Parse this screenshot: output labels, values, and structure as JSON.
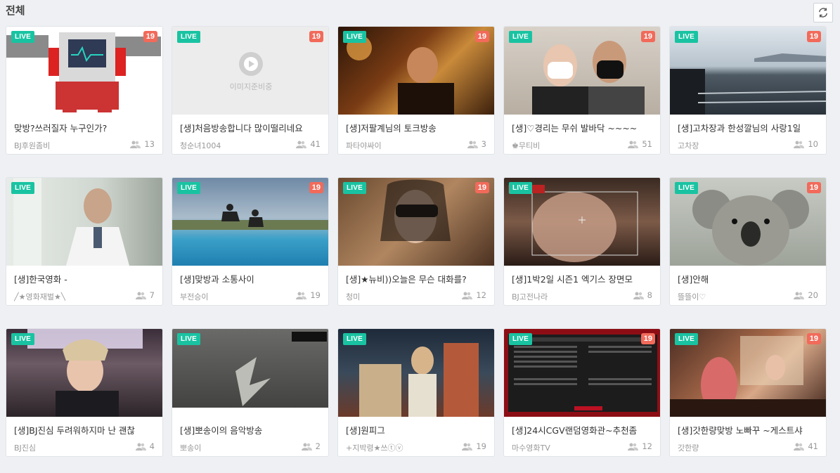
{
  "page": {
    "title": "전체"
  },
  "cards": [
    {
      "title": "맞방?쓰러질자 누구인가?",
      "bj": "BJ후원좀비",
      "viewers": "13",
      "live": "LIVE",
      "age": "19"
    },
    {
      "title": "[생]처음방송합니다 많이떨리네요",
      "bj": "청순녀1004",
      "viewers": "41",
      "live": "LIVE",
      "age": "19",
      "placeholder": "이미지준비중"
    },
    {
      "title": "[생]저팔계님의 토크방송",
      "bj": "파타야싸이",
      "viewers": "3",
      "live": "LIVE",
      "age": "19"
    },
    {
      "title": "[생]♡경리는 무쉬 발바닥 ~~~~",
      "bj": "♚무티비",
      "viewers": "51",
      "live": "LIVE",
      "age": "19"
    },
    {
      "title": "[생]고차장과 한성깔님의 사랑1일",
      "bj": "고차장",
      "viewers": "10",
      "live": "LIVE",
      "age": "19"
    },
    {
      "title": "[생]한국영화 -",
      "bj": "╱★영화재벌★╲",
      "viewers": "7",
      "live": "LIVE"
    },
    {
      "title": "[생]맞방과 소통사이",
      "bj": "부전승이",
      "viewers": "19",
      "live": "LIVE",
      "age": "19"
    },
    {
      "title": "[생]★뉴비))오늘은 무슨 대화를?",
      "bj": "청미",
      "viewers": "12",
      "live": "LIVE",
      "age": "19"
    },
    {
      "title": "[생]1박2일 시즌1 엑기스 장면모",
      "bj": "BJ고전나라",
      "viewers": "8",
      "live": "LIVE"
    },
    {
      "title": "[생]안해",
      "bj": "뜰뜰이♡",
      "viewers": "20",
      "live": "LIVE",
      "age": "19"
    },
    {
      "title": "[생]BJ진심 두려워하지마 난 괜찮",
      "bj": "BJ진심",
      "viewers": "4",
      "live": "LIVE"
    },
    {
      "title": "[생]뽀송이의 음악방송",
      "bj": "뽀송이",
      "viewers": "2",
      "live": "LIVE"
    },
    {
      "title": "[생]원피그",
      "bj": "+지박령★쓰ⓣⓥ",
      "viewers": "19",
      "live": "LIVE"
    },
    {
      "title": "[생]24시CGV랜덤영화관~추천좀",
      "bj": "마수영화TV",
      "viewers": "12",
      "live": "LIVE",
      "age": "19"
    },
    {
      "title": "[생]갓한량맞방 노빠꾸 ~게스트샤",
      "bj": "갓한량",
      "viewers": "41",
      "live": "LIVE",
      "age": "19"
    }
  ],
  "colors": {
    "live": "#19c3a2",
    "age": "#f26a5a",
    "background": "#eef0f3"
  },
  "icons": {
    "refresh": "refresh-icon",
    "viewers": "viewers-icon",
    "play": "play-icon"
  }
}
